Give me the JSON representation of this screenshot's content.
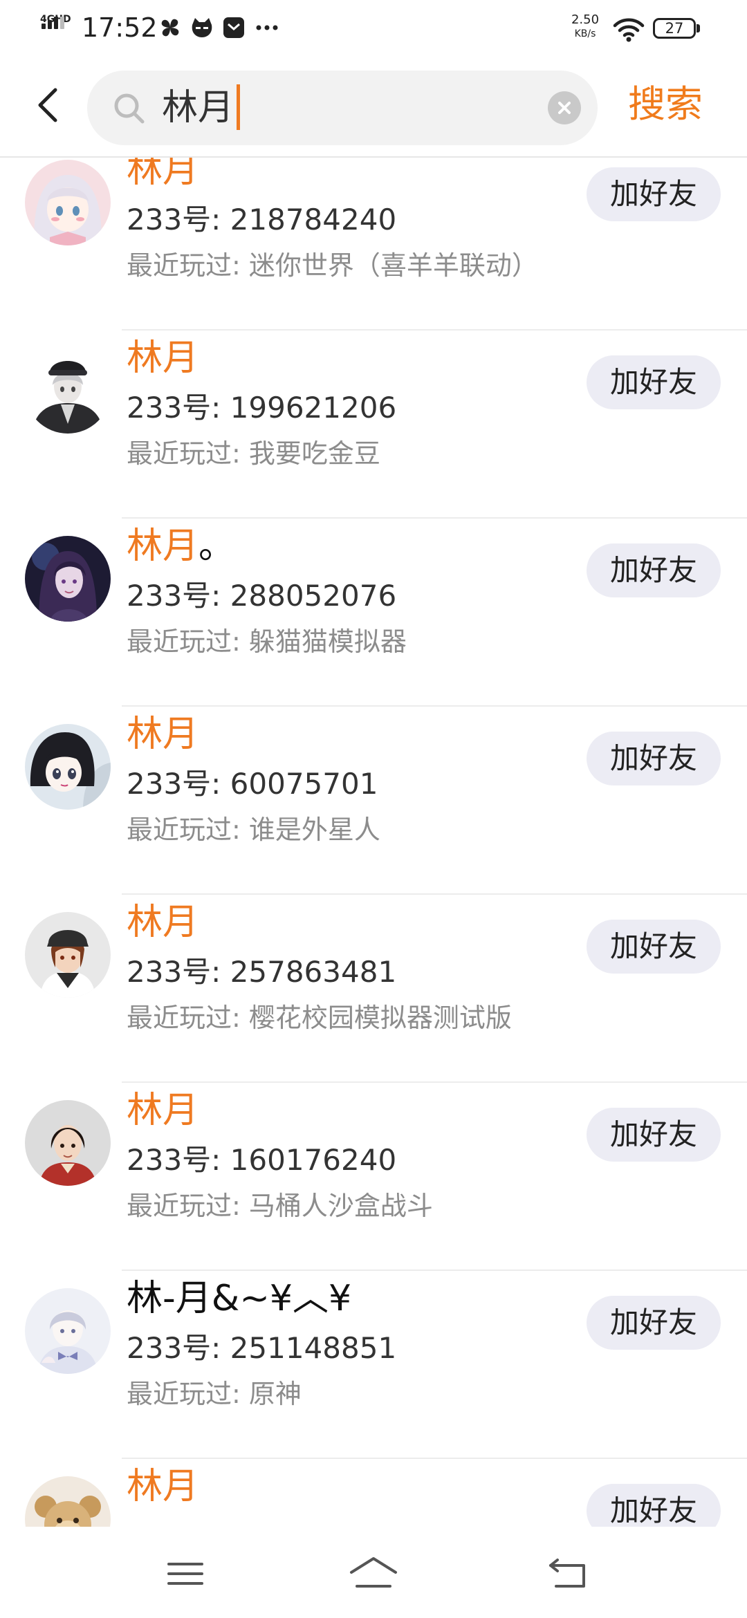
{
  "status_bar": {
    "network": "4GHD",
    "time": "17:52",
    "speed_value": "2.50",
    "speed_unit": "KB/s",
    "battery": "27",
    "icons": [
      "pinwheel-icon",
      "cat-face-icon",
      "envelope-icon",
      "more-dots-icon"
    ]
  },
  "search": {
    "query": "林月",
    "submit_label": "搜索",
    "icons": {
      "back": "chevron-left-icon",
      "search": "search-icon",
      "clear": "clear-icon"
    }
  },
  "colors": {
    "accent": "#ef7a21",
    "button_bg": "#ececf4",
    "secondary_text": "#8c8c8c"
  },
  "results": [
    {
      "name_highlight": "林月",
      "name_rest": "",
      "uid": "233号: 218784240",
      "played": "最近玩过: 迷你世界（喜羊羊联动）",
      "button": "加好友"
    },
    {
      "name_highlight": "林月",
      "name_rest": "",
      "uid": "233号: 199621206",
      "played": "最近玩过: 我要吃金豆",
      "button": "加好友"
    },
    {
      "name_highlight": "林月",
      "name_rest": "。",
      "uid": "233号: 288052076",
      "played": "最近玩过: 躲猫猫模拟器",
      "button": "加好友"
    },
    {
      "name_highlight": "林月",
      "name_rest": "",
      "uid": "233号: 60075701",
      "played": "最近玩过: 谁是外星人",
      "button": "加好友"
    },
    {
      "name_highlight": "林月",
      "name_rest": "",
      "uid": "233号: 257863481",
      "played": "最近玩过: 樱花校园模拟器测试版",
      "button": "加好友"
    },
    {
      "name_highlight": "林月",
      "name_rest": "",
      "uid": "233号: 160176240",
      "played": "最近玩过: 马桶人沙盒战斗",
      "button": "加好友"
    },
    {
      "name_highlight": "",
      "name_rest": "林-月&~¥︿¥",
      "uid": "233号: 251148851",
      "played": "最近玩过: 原神",
      "button": "加好友"
    },
    {
      "name_highlight": "林月",
      "name_rest": "",
      "uid": "",
      "played": "",
      "button": "加好友"
    }
  ],
  "nav": {
    "icons": [
      "menu-icon",
      "home-icon",
      "back-arrow-icon"
    ]
  }
}
